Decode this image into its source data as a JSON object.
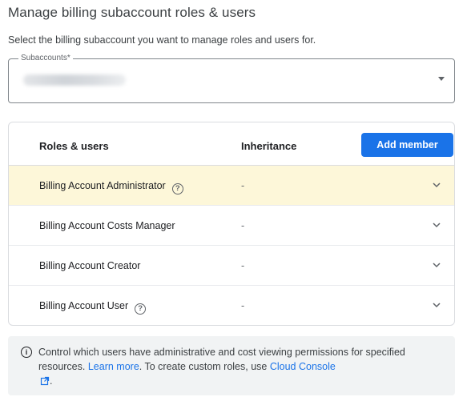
{
  "page": {
    "title": "Manage billing subaccount roles & users",
    "subtitle": "Select the billing subaccount you want to manage roles and users for."
  },
  "subaccount_select": {
    "label": "Subaccounts*",
    "value_redacted": true
  },
  "table": {
    "headers": {
      "roles": "Roles & users",
      "inheritance": "Inheritance"
    },
    "add_button": "Add member",
    "rows": [
      {
        "role": "Billing Account Administrator",
        "inheritance": "-",
        "has_help": true,
        "highlighted": true
      },
      {
        "role": "Billing Account Costs Manager",
        "inheritance": "-",
        "has_help": false,
        "highlighted": false
      },
      {
        "role": "Billing Account Creator",
        "inheritance": "-",
        "has_help": false,
        "highlighted": false
      },
      {
        "role": "Billing Account User",
        "inheritance": "-",
        "has_help": true,
        "highlighted": false
      }
    ],
    "help_icon_glyph": "?"
  },
  "info": {
    "icon_glyph": "i",
    "text_before": "Control which users have administrative and cost viewing permissions for specified resources. ",
    "learn_more": "Learn more",
    "text_middle": ". To create custom roles, use ",
    "cloud_console": "Cloud Console",
    "text_end": "."
  },
  "colors": {
    "accent": "#1a73e8",
    "highlight_row": "#fdf7d9",
    "info_bg": "#f1f3f4"
  },
  "icons": {
    "row_expand": "chevron-down-icon",
    "help": "help-circle-icon",
    "info": "info-circle-icon",
    "external": "external-link-icon",
    "select": "dropdown-caret-icon"
  }
}
